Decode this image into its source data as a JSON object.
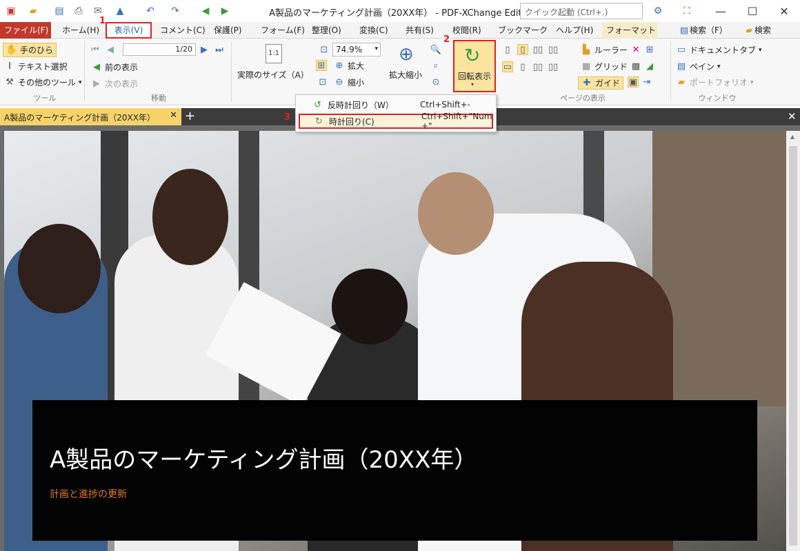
{
  "window": {
    "title": "A製品のマーケティング計画（20XX年） - PDF-XChange Editor",
    "quick_launch_placeholder": "クイック起動 (Ctrl+.)"
  },
  "menu": {
    "items": [
      "ファイル(F)",
      "ホーム(H)",
      "表示(V)",
      "コメント(C)",
      "保護(P)",
      "フォーム(F)",
      "整理(O)",
      "変換(C)",
      "共有(S)",
      "校閲(R)",
      "ブックマーク",
      "ヘルプ(H)",
      "フォーマット"
    ],
    "right": [
      "検索（F）",
      "検索"
    ]
  },
  "ribbon": {
    "tools": {
      "hand": "手のひら",
      "text_select": "テキスト選択",
      "other": "その他のツール",
      "group": "ツール"
    },
    "nav": {
      "page_value": "1",
      "page_total": "/20",
      "prev_view": "前の表示",
      "next_view": "次の表示",
      "group": "移動"
    },
    "zoom": {
      "actual_size": "実際のサイズ（A）",
      "zoom_value": "74.9%",
      "zoom_in": "拡大",
      "zoom_out": "縮小",
      "zoom_tool": "拡大縮小"
    },
    "rotate": {
      "label": "回転表示"
    },
    "page_display": {
      "group": "ページの表示",
      "ruler": "ルーラー",
      "grid": "グリッド",
      "guide": "ガイド"
    },
    "window": {
      "doc_tabs": "ドキュメントタブ",
      "pane": "ペイン",
      "portfolio": "ポートフォリオ",
      "group": "ウィンドウ"
    }
  },
  "rotate_menu": {
    "items": [
      {
        "label": "反時計回り（W）",
        "shortcut": "Ctrl+Shift+-"
      },
      {
        "label": "時計回り(C)",
        "shortcut": "Ctrl+Shift+\"Num +\""
      }
    ]
  },
  "annotations": {
    "step1": "1",
    "step2": "2",
    "step3": "3"
  },
  "document": {
    "tab_title": "A製品のマーケティング計画（20XX年）",
    "slide_title": "A製品のマーケティング計画（20XX年）",
    "slide_subtitle": "計画と進捗の更新"
  }
}
